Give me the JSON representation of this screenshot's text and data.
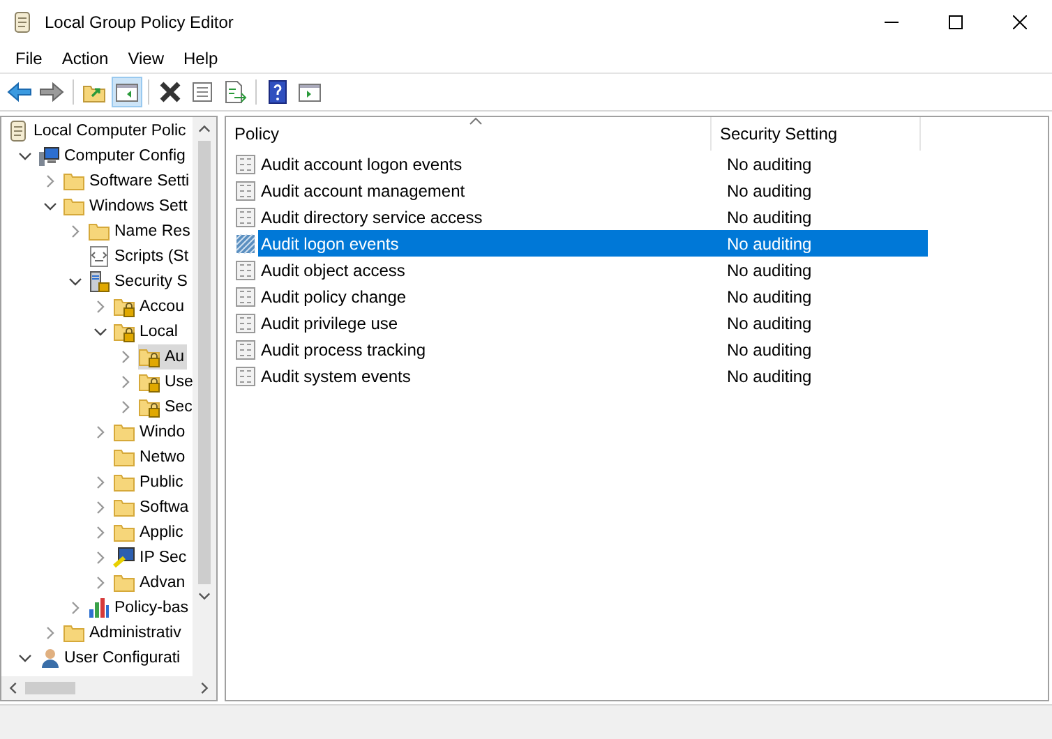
{
  "window": {
    "title": "Local Group Policy Editor"
  },
  "menu": [
    "File",
    "Action",
    "View",
    "Help"
  ],
  "toolbar": [
    {
      "kind": "back"
    },
    {
      "kind": "forward"
    },
    {
      "kind": "separator"
    },
    {
      "kind": "up"
    },
    {
      "kind": "tree",
      "pressed": true
    },
    {
      "kind": "separator"
    },
    {
      "kind": "delete"
    },
    {
      "kind": "properties"
    },
    {
      "kind": "export"
    },
    {
      "kind": "separator"
    },
    {
      "kind": "help"
    },
    {
      "kind": "pane"
    }
  ],
  "tree": [
    {
      "label": "Local Computer Polic",
      "kind": "scroll",
      "selected": false,
      "children": [
        {
          "label": "Computer Config",
          "kind": "computer",
          "expanded": true,
          "selected": false,
          "children": [
            {
              "label": "Software Setti",
              "kind": "folder",
              "expanded": false,
              "selected": false
            },
            {
              "label": "Windows Sett",
              "kind": "folder",
              "expanded": true,
              "selected": false,
              "children": [
                {
                  "label": "Name Res",
                  "kind": "folder",
                  "expanded": false,
                  "selected": false
                },
                {
                  "label": "Scripts (St",
                  "kind": "script",
                  "selected": false
                },
                {
                  "label": "Security S",
                  "kind": "security",
                  "expanded": true,
                  "selected": false,
                  "children": [
                    {
                      "label": "Accou",
                      "kind": "lockfolder",
                      "expanded": false,
                      "selected": false
                    },
                    {
                      "label": "Local",
                      "kind": "lockfolder",
                      "expanded": true,
                      "selected": false,
                      "children": [
                        {
                          "label": "Au",
                          "kind": "lockfolder",
                          "expanded": false,
                          "selected": true
                        },
                        {
                          "label": "Use",
                          "kind": "lockfolder",
                          "expanded": false,
                          "selected": false
                        },
                        {
                          "label": "Sec",
                          "kind": "lockfolder",
                          "expanded": false,
                          "selected": false
                        }
                      ]
                    },
                    {
                      "label": "Windo",
                      "kind": "folder",
                      "expanded": false,
                      "selected": false
                    },
                    {
                      "label": "Netwo",
                      "kind": "folder",
                      "selected": false
                    },
                    {
                      "label": "Public",
                      "kind": "folder",
                      "expanded": false,
                      "selected": false
                    },
                    {
                      "label": "Softwa",
                      "kind": "folder",
                      "expanded": false,
                      "selected": false
                    },
                    {
                      "label": "Applic",
                      "kind": "folder",
                      "expanded": false,
                      "selected": false
                    },
                    {
                      "label": "IP Sec",
                      "kind": "ipsec",
                      "expanded": false,
                      "selected": false
                    },
                    {
                      "label": "Advan",
                      "kind": "folder",
                      "expanded": false,
                      "selected": false
                    }
                  ]
                },
                {
                  "label": "Policy-bas",
                  "kind": "chart",
                  "expanded": false,
                  "selected": false
                }
              ]
            },
            {
              "label": "Administrativ",
              "kind": "folder",
              "expanded": false,
              "selected": false
            }
          ]
        },
        {
          "label": "User Configurati",
          "kind": "user",
          "expanded": true,
          "selected": false
        }
      ]
    }
  ],
  "table": {
    "columns": [
      {
        "label": "Policy",
        "sorted": true
      },
      {
        "label": "Security Setting",
        "sorted": false
      }
    ],
    "rows": [
      {
        "policy": "Audit account logon events",
        "setting": "No auditing",
        "selected": false
      },
      {
        "policy": "Audit account management",
        "setting": "No auditing",
        "selected": false
      },
      {
        "policy": "Audit directory service access",
        "setting": "No auditing",
        "selected": false
      },
      {
        "policy": "Audit logon events",
        "setting": "No auditing",
        "selected": true
      },
      {
        "policy": "Audit object access",
        "setting": "No auditing",
        "selected": false
      },
      {
        "policy": "Audit policy change",
        "setting": "No auditing",
        "selected": false
      },
      {
        "policy": "Audit privilege use",
        "setting": "No auditing",
        "selected": false
      },
      {
        "policy": "Audit process tracking",
        "setting": "No auditing",
        "selected": false
      },
      {
        "policy": "Audit system events",
        "setting": "No auditing",
        "selected": false
      }
    ]
  }
}
